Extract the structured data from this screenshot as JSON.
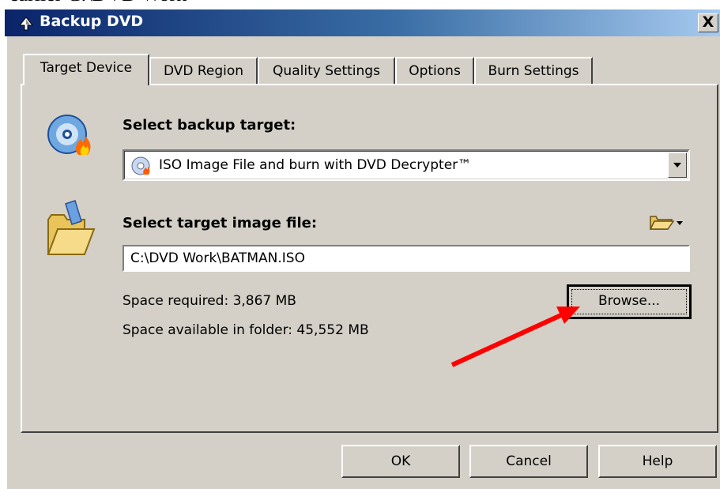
{
  "cropped_text": "earlier C:\\DVD Work",
  "window": {
    "title": "Backup DVD",
    "close_label": "X"
  },
  "tabs": [
    {
      "label": "Target Device",
      "active": true
    },
    {
      "label": "DVD Region",
      "active": false
    },
    {
      "label": "Quality Settings",
      "active": false
    },
    {
      "label": "Options",
      "active": false
    },
    {
      "label": "Burn Settings",
      "active": false
    }
  ],
  "target": {
    "label": "Select backup target:",
    "selected": "ISO Image File and burn with DVD Decrypter™"
  },
  "image_file": {
    "label": "Select target image file:",
    "value": "C:\\DVD Work\\BATMAN.ISO",
    "browse_label": "Browse...",
    "space_required": "Space required:  3,867 MB",
    "space_available": "Space available in folder:  45,552 MB"
  },
  "buttons": {
    "ok": "OK",
    "cancel": "Cancel",
    "help": "Help"
  },
  "colors": {
    "titlebar_start": "#0a246a",
    "titlebar_end": "#a6caf0",
    "annotation_arrow": "#ff0000"
  }
}
